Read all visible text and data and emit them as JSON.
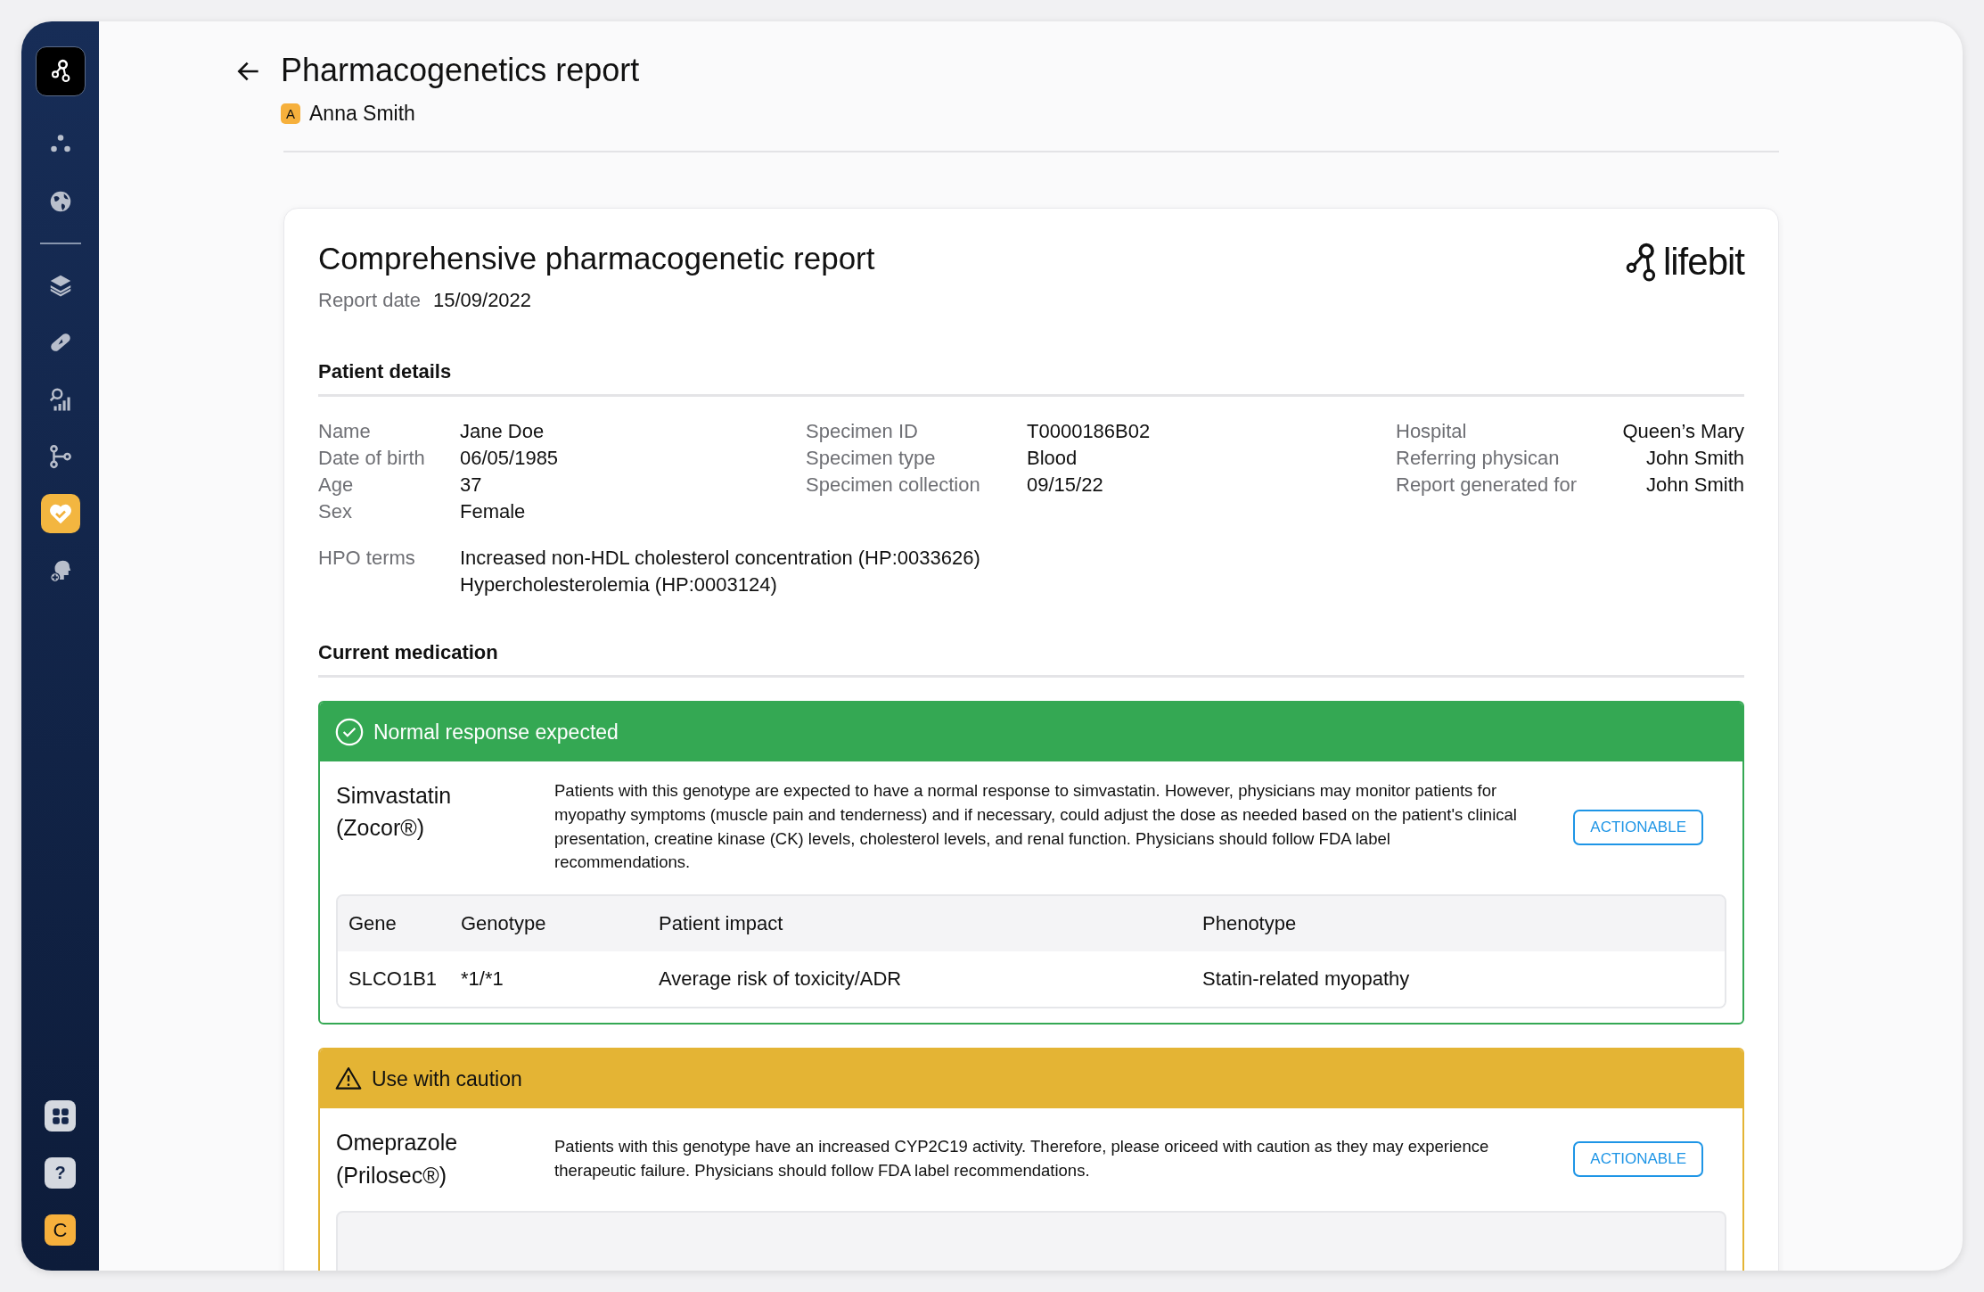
{
  "sidebar": {
    "top_items": [
      {
        "kind": "dots",
        "selected": false
      },
      {
        "kind": "globe",
        "selected": false
      }
    ],
    "items": [
      {
        "kind": "layers",
        "selected": false
      },
      {
        "kind": "pill",
        "selected": false
      },
      {
        "kind": "chart",
        "selected": false
      },
      {
        "kind": "branch",
        "selected": false
      },
      {
        "kind": "heart",
        "selected": true
      },
      {
        "kind": "head",
        "selected": false
      }
    ],
    "bottom": [
      {
        "kind": "grid"
      },
      {
        "kind": "help",
        "label": "?"
      },
      {
        "kind": "avatar",
        "label": "C"
      }
    ]
  },
  "header": {
    "title": "Pharmacogenetics report",
    "user": {
      "initial": "A",
      "name": "Anna Smith"
    }
  },
  "report": {
    "title": "Comprehensive pharmacogenetic report",
    "date_label": "Report date",
    "date": "15/09/2022",
    "logo_text": "lifebit",
    "patient_details": {
      "heading": "Patient details",
      "columns": [
        [
          {
            "label": "Name",
            "value": "Jane Doe"
          },
          {
            "label": "Date of birth",
            "value": "06/05/1985"
          },
          {
            "label": "Age",
            "value": "37"
          },
          {
            "label": "Sex",
            "value": "Female"
          }
        ],
        [
          {
            "label": "Specimen ID",
            "value": "T0000186B02"
          },
          {
            "label": "Specimen type",
            "value": "Blood"
          },
          {
            "label": "Specimen collection",
            "value": "09/15/22"
          }
        ],
        [
          {
            "label": "Hospital",
            "value": "Queen’s Mary"
          },
          {
            "label": "Referring physican",
            "value": "John Smith"
          },
          {
            "label": "Report generated for",
            "value": "John Smith"
          }
        ]
      ],
      "hpo_label": "HPO terms",
      "hpo_terms": [
        "Increased non-HDL cholesterol concentration (HP:0033626)",
        "Hypercholesterolemia (HP:0003124)"
      ]
    },
    "medication": {
      "heading": "Current medication",
      "groups": [
        {
          "kind": "normal",
          "title": "Normal response expected",
          "drug": "Simvastatin (Zocor®)",
          "description": "Patients with this genotype are expected to have a normal response to simvastatin. However, physicians may monitor patients for myopathy symptoms (muscle pain and tenderness) and if necessary, could adjust the dose as needed based on the patient's clinical presentation, creatine kinase (CK) levels, cholesterol levels, and renal function. Physicians should follow FDA label recommendations.",
          "badge": "ACTIONABLE",
          "table": {
            "columns": [
              "Gene",
              "Genotype",
              "Patient impact",
              "Phenotype"
            ],
            "rows": [
              [
                "SLCO1B1",
                "*1/*1",
                "Average risk of toxicity/ADR",
                "Statin-related myopathy"
              ]
            ]
          }
        },
        {
          "kind": "caution",
          "title": "Use with caution",
          "drug": "Omeprazole (Prilosec®)",
          "description": "Patients with this genotype have an increased CYP2C19 activity. Therefore, please oriceed with caution as they may experience therapeutic failure. Physicians should follow FDA label recommendations.",
          "badge": "ACTIONABLE"
        }
      ]
    }
  }
}
